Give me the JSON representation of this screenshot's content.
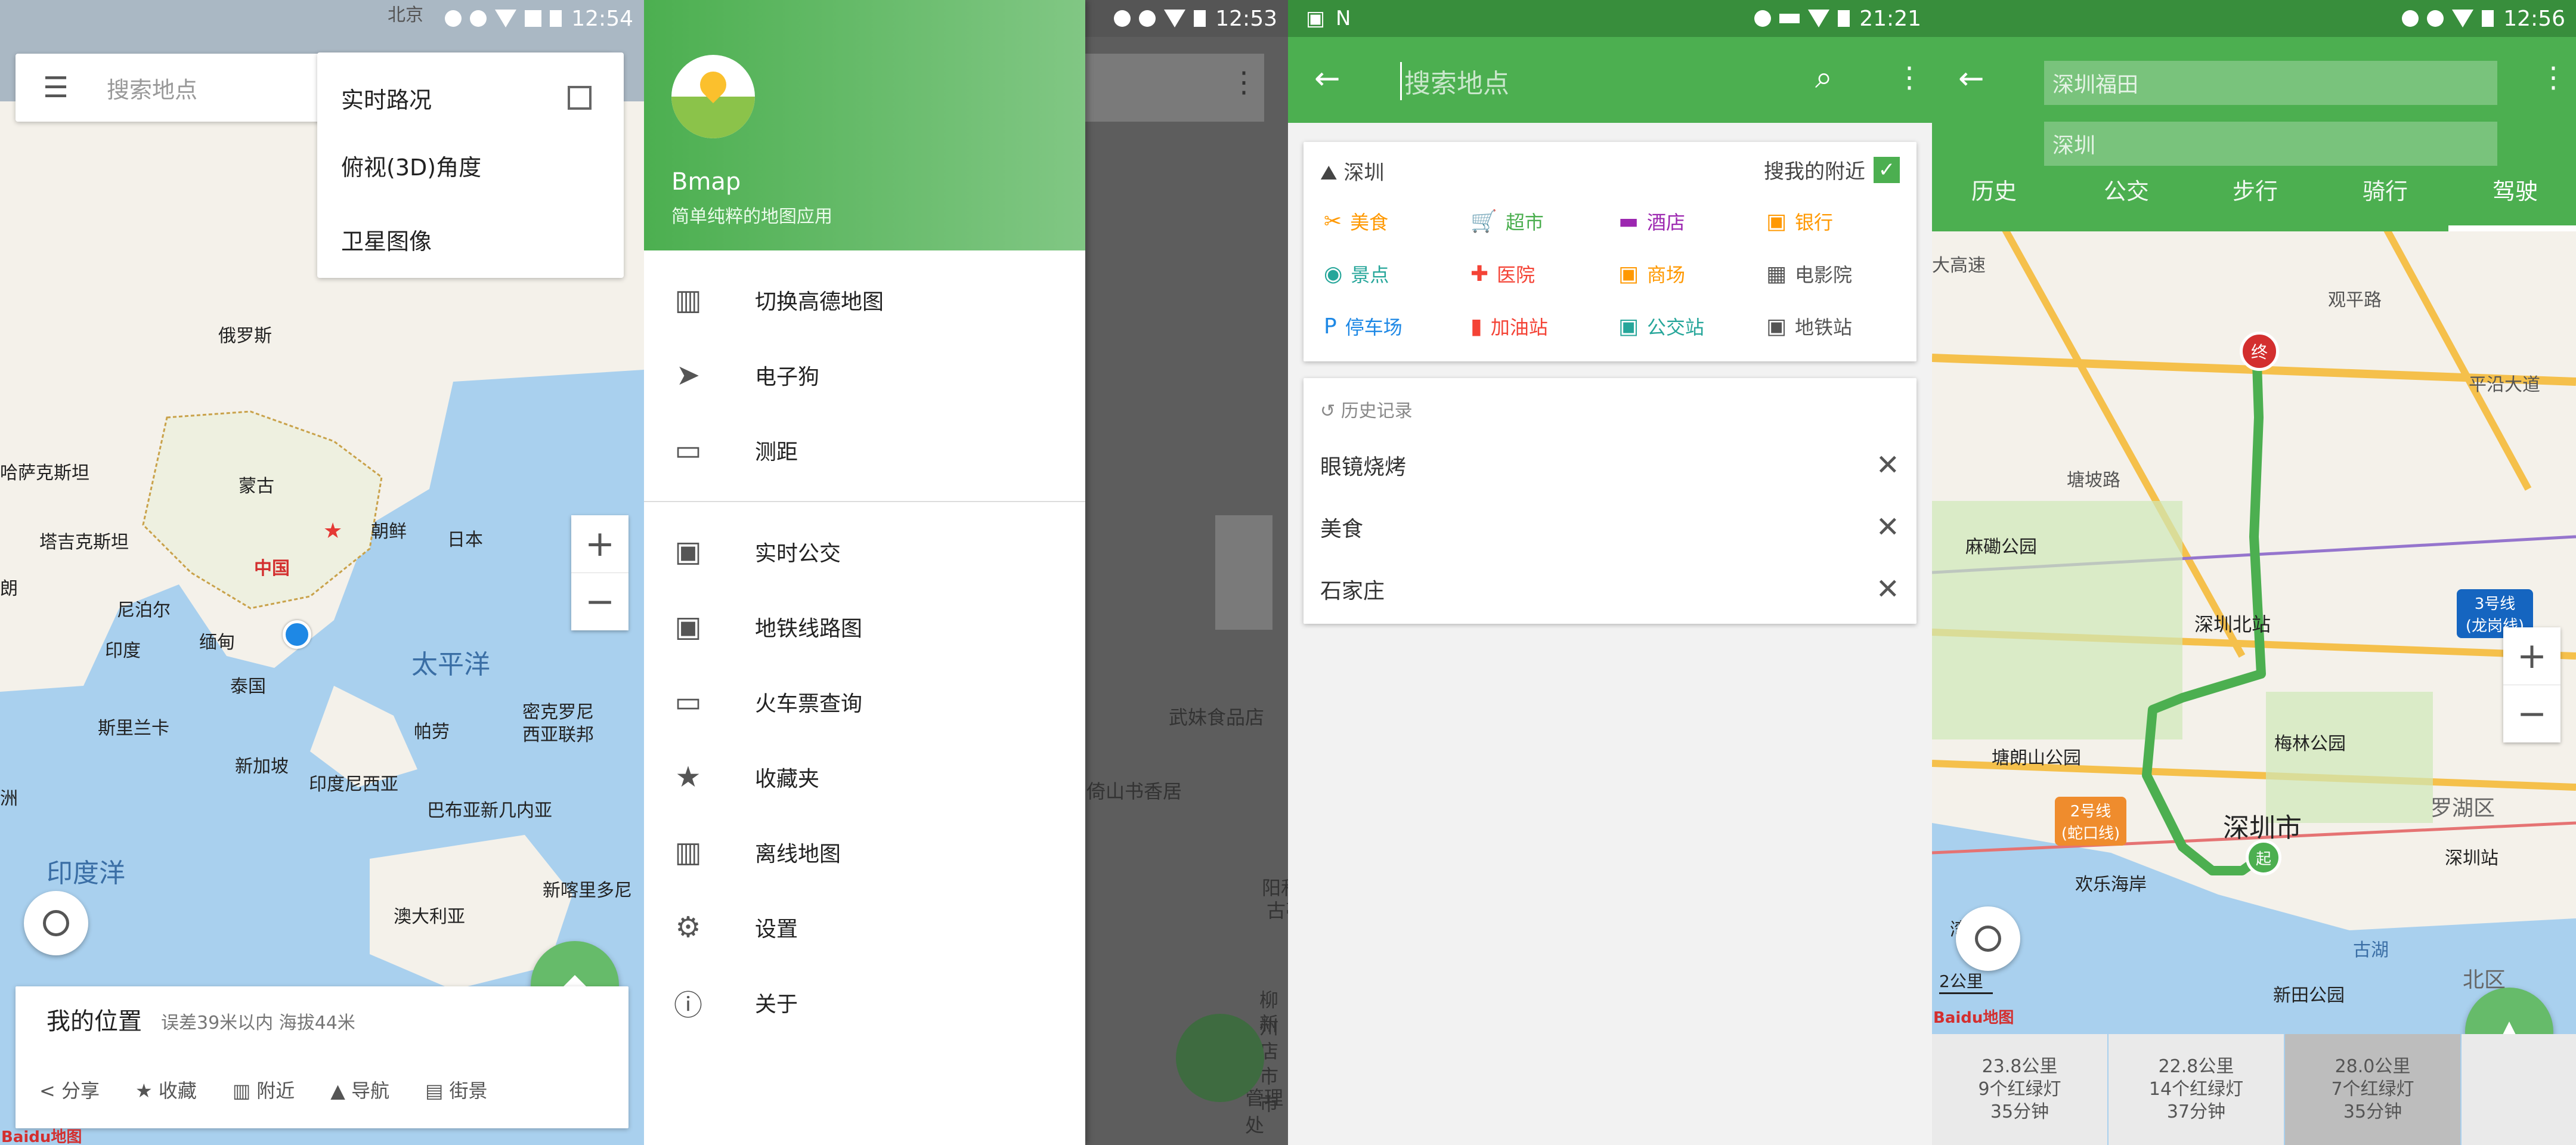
{
  "panel1": {
    "status_time": "12:54",
    "search_placeholder": "搜索地点",
    "menu": [
      "实时路况",
      "俯视(3D)角度",
      "卫星图像"
    ],
    "map_labels": {
      "kazakhstan": "哈萨克斯坦",
      "russia": "俄罗斯",
      "mongolia": "蒙古",
      "tajikistan": "塔吉克斯坦",
      "nepal": "尼泊尔",
      "china": "中国",
      "korea": "朝鲜",
      "japan": "日本",
      "pacific": "太平洋",
      "india": "印度",
      "myanmar": "缅甸",
      "thailand": "泰国",
      "srilanka": "斯里兰卡",
      "palau": "帕劳",
      "micronesia": "密克罗尼西亚联邦",
      "singapore": "新加坡",
      "indonesia": "印度尼西亚",
      "png": "巴布亚新几内亚",
      "indian_ocean": "印度洋",
      "australia": "澳大利亚",
      "new_caledonia": "新喀里多尼",
      "north_beijing": "北京",
      "lang_partial": "朗",
      "africa_partial": "洲"
    },
    "bottom_card": {
      "title": "我的位置",
      "subtitle": "误差39米以内  海拔44米",
      "actions": [
        "分享",
        "收藏",
        "附近",
        "导航",
        "街景"
      ]
    },
    "baidu_logo": "Baidu地图"
  },
  "panel2": {
    "status_time": "12:53",
    "app_name": "Bmap",
    "app_desc": "简单纯粹的地图应用",
    "items": [
      "切换高德地图",
      "电子狗",
      "测距",
      "实时公交",
      "地铁线路图",
      "火车票查询",
      "收藏夹",
      "离线地图",
      "设置",
      "关于"
    ],
    "bg_labels": [
      "武妹食品店",
      "倚山书香居",
      "阳和工业",
      "古亭山",
      "柳州",
      "新店",
      "市市",
      "管理处"
    ]
  },
  "panel3": {
    "status_time": "21:21",
    "search_placeholder": "搜索地点",
    "city": "深圳",
    "nearby": "搜我的附近",
    "categories": [
      {
        "label": "美食",
        "color": "#ff9800"
      },
      {
        "label": "超市",
        "color": "#4caf50"
      },
      {
        "label": "酒店",
        "color": "#9c27b0"
      },
      {
        "label": "银行",
        "color": "#ff9800"
      },
      {
        "label": "景点",
        "color": "#26a69a"
      },
      {
        "label": "医院",
        "color": "#f44336"
      },
      {
        "label": "商场",
        "color": "#ff9800"
      },
      {
        "label": "电影院",
        "color": "#555555"
      },
      {
        "label": "停车场",
        "color": "#1e88e5"
      },
      {
        "label": "加油站",
        "color": "#f44336"
      },
      {
        "label": "公交站",
        "color": "#26a69a"
      },
      {
        "label": "地铁站",
        "color": "#555555"
      }
    ],
    "history_title": "历史记录",
    "history": [
      "眼镜烧烤",
      "美食",
      "石家庄"
    ]
  },
  "panel4": {
    "status_time": "12:56",
    "from": "深圳福田",
    "to": "深圳",
    "tabs": [
      "历史",
      "公交",
      "步行",
      "骑行",
      "驾驶"
    ],
    "map_labels": {
      "mabu": "麻磡公园",
      "north_station": "深圳北站",
      "meilin": "梅林公园",
      "tanglang": "塘朗山公园",
      "shenzhen_city": "深圳市",
      "luohu": "罗湖区",
      "shenzhen_station": "深圳站",
      "huanle": "欢乐海岸",
      "bay": "湾仔心",
      "guhu": "古湖",
      "xintian": "新田公园",
      "north_district": "北区",
      "line3": "3号线\n(龙岗线)",
      "line2": "2号线\n(蛇口线)",
      "scale": "2公里",
      "dagaosu": "大高速",
      "guanping": "观平路",
      "pingyan": "平沿大道",
      "tuanpo": "塘坡路"
    },
    "routes": [
      {
        "dist": "23.8公里",
        "lights": "9个红绿灯",
        "time": "35分钟"
      },
      {
        "dist": "22.8公里",
        "lights": "14个红绿灯",
        "time": "37分钟"
      },
      {
        "dist": "28.0公里",
        "lights": "7个红绿灯",
        "time": "35分钟"
      }
    ],
    "baidu_logo": "Baidu地图"
  }
}
